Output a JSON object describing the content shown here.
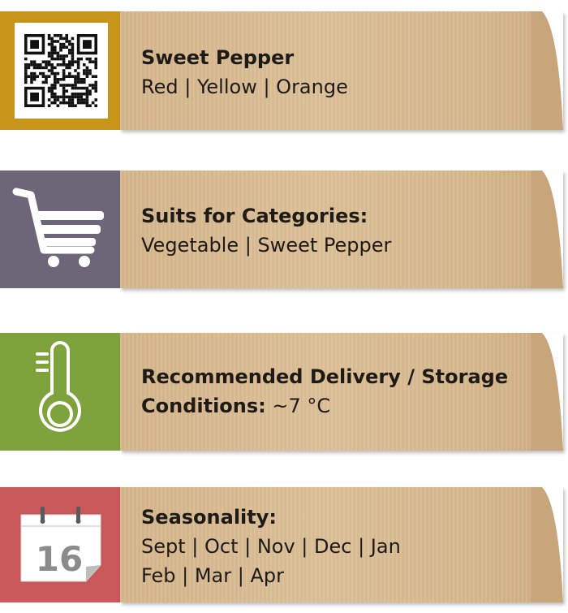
{
  "cards": [
    {
      "icon": "qr-code-icon",
      "title": "Sweet Pepper",
      "line1": "Red | Yellow | Orange",
      "color": "#c8951a"
    },
    {
      "icon": "shopping-cart-icon",
      "title": "Suits for Categories:",
      "line1": "Vegetable | Sweet Pepper",
      "color": "#6b6778"
    },
    {
      "icon": "thermometer-icon",
      "title": "Recommended Delivery / Storage",
      "title2": "Conditions:",
      "value": "~7 °C",
      "color": "#7fa33c"
    },
    {
      "icon": "calendar-icon",
      "calendar_day": "16",
      "title": "Seasonality:",
      "line1": "Sept | Oct | Nov | Dec | Jan",
      "line2": "Feb | Mar | Apr",
      "color": "#c9585a"
    }
  ]
}
